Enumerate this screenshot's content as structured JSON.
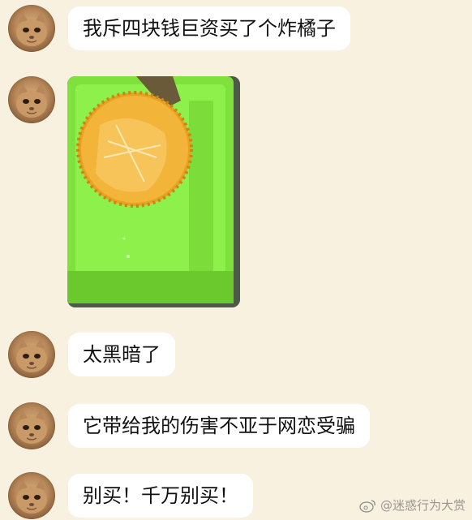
{
  "messages": [
    {
      "type": "text",
      "text": "我斥四块钱巨资买了个炸橘子"
    },
    {
      "type": "image",
      "alt": "炸橘子"
    },
    {
      "type": "text",
      "text": "太黑暗了"
    },
    {
      "type": "text",
      "text": "它带给我的伤害不亚于网恋受骗"
    },
    {
      "type": "text",
      "text": "别买！千万别买！"
    }
  ],
  "watermark": {
    "text": "@迷惑行为大赏",
    "icon": "weibo-icon"
  },
  "colors": {
    "background": "#f8f1df",
    "bubble": "#ffffff",
    "tray": "#7fe23c"
  }
}
